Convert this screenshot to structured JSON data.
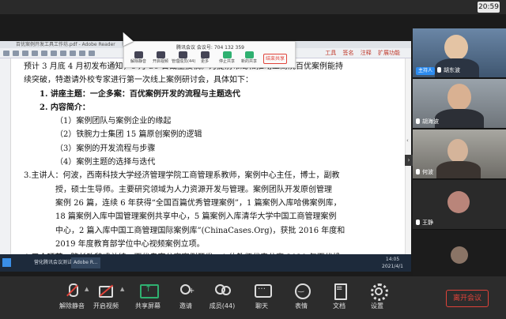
{
  "clock": "20:59",
  "share_window": {
    "title": "百优案例开发工具工作坊.pdf - Adobe Reader",
    "tools_right": [
      "工具",
      "签名",
      "注释",
      "扩展功能"
    ],
    "taskbar_items": [
      "营化腾讯会议测试...",
      "Adobe R..."
    ],
    "taskbar_time": "14:05",
    "taskbar_date": "2021/4/1"
  },
  "float_toolbar": {
    "meeting_id": "腾讯会议 会议号: 704 132 359",
    "buttons": [
      "解除静音",
      "开启视频",
      "管理成员(44)",
      "更多",
      "停止共享",
      "新的共享"
    ],
    "end_label": "结束共享"
  },
  "document": {
    "lines": [
      "预计 3 月底 4 月初发布通知，6 月 30 日截至投稿。为提前布局和推动工商院百优案例能持",
      "续突破，特邀请外校专家进行第一次线上案例研讨会，具体如下："
    ],
    "section1": "1. 讲座主题：一企多案：百优案例开发的流程与主题迭代",
    "section2": "2. 内容简介：",
    "items": [
      "（1）案例团队与案例企业的缘起",
      "（2）铁腕力士集团 15 篇原创案例的逻辑",
      "（3）案例的开发流程与步骤",
      "（4）案例主题的选择与迭代"
    ],
    "speaker": [
      "3.主讲人：何波，西南科技大学经济管理学院工商管理系教师，案例中心主任，博士，副教",
      "授，硕士生导师。主要研究领域为人力资源开发与管理。案例团队开发原创管理",
      "案例 26 篇，连续 6 年获得“全国百篇优秀管理案例”，1 篇案例入库哈佛案例库，",
      "18 篇案例入库中国管理案例共享中心，5 篇案例入库清华大学中国工商管理案例",
      "中心，2 篇入库中国工商管理国际案例库”(ChinaCases.Org)，获批 2016 年度和",
      "2019 年度教育部学位中心视频案例立项。"
    ],
    "cutoff": "4.三个环节：院长致辞或总结，百优专家分享案例开发，4 位教师代表分享 2020 年百优投"
  },
  "participants": [
    {
      "name": "胡东波",
      "host_badge": "主持人"
    },
    {
      "name": "胡海波"
    },
    {
      "name": "何波"
    },
    {
      "name": "王静"
    },
    {
      "name": ""
    }
  ],
  "controls": [
    {
      "label": "解除静音",
      "icon": "mic-muted-icon"
    },
    {
      "label": "开启视频",
      "icon": "camera-off-icon"
    },
    {
      "label": "共享屏幕",
      "icon": "share-screen-icon"
    },
    {
      "label": "邀请",
      "icon": "invite-icon"
    },
    {
      "label": "成员(44)",
      "icon": "members-icon"
    },
    {
      "label": "聊天",
      "icon": "chat-icon"
    },
    {
      "label": "表情",
      "icon": "emoji-icon"
    },
    {
      "label": "文档",
      "icon": "document-icon"
    },
    {
      "label": "设置",
      "icon": "settings-icon"
    }
  ],
  "leave_label": "离开会议",
  "colors": {
    "accent_red": "#e0433a",
    "share_green": "#2fb070",
    "host_blue": "#2d8cf0"
  }
}
